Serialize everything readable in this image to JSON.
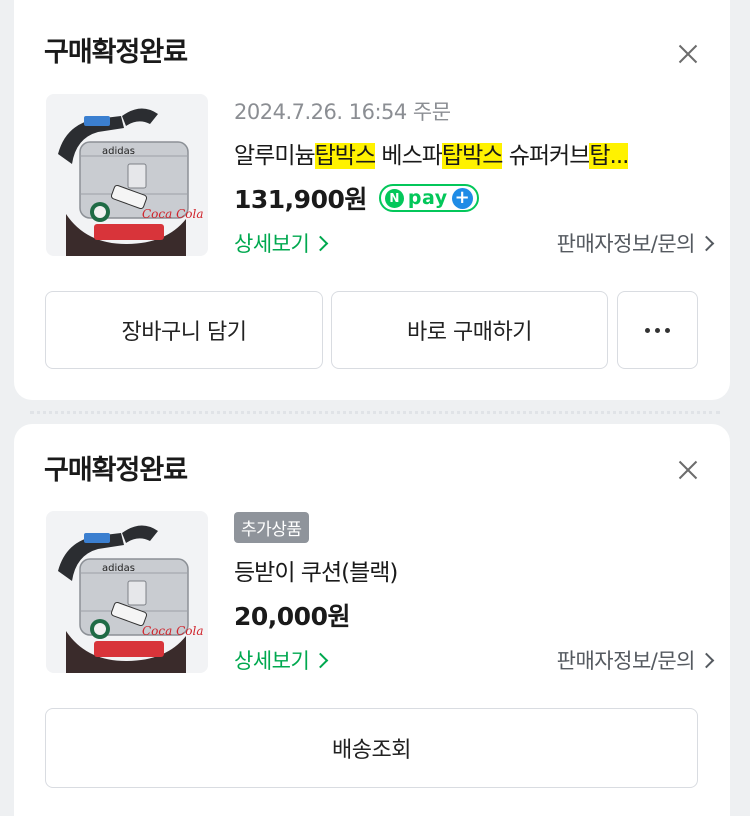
{
  "orders": [
    {
      "status": "구매확정완료",
      "order_date": "2024.7.26. 16:54 주문",
      "product_name_parts": [
        "알루미늄",
        "탑박스",
        " 베스파",
        "탑박스",
        " 슈퍼커브",
        "탑..."
      ],
      "price": "131,900원",
      "npay_label": "pay",
      "detail_label": "상세보기",
      "seller_label": "판매자정보/문의",
      "buttons": {
        "cart": "장바구니 담기",
        "buy_now": "바로 구매하기"
      }
    },
    {
      "status": "구매확정완료",
      "badge": "추가상품",
      "product_name": "등받이 쿠션(블랙)",
      "price": "20,000원",
      "detail_label": "상세보기",
      "seller_label": "판매자정보/문의",
      "buttons": {
        "shipping": "배송조회"
      }
    }
  ],
  "thumb_text": {
    "brand1": "adidas",
    "brand2": "Coca Cola"
  },
  "colors": {
    "accent_green": "#00a84f",
    "npay_green": "#03c75a",
    "highlight": "#fff200"
  },
  "icons": {
    "close": "close-icon",
    "more": "more-dots-icon",
    "chevron": "chevron-right-icon"
  }
}
